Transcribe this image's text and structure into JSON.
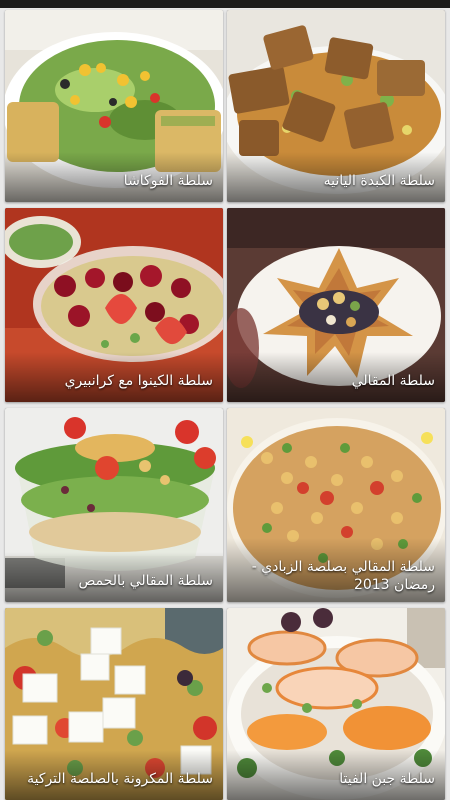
{
  "recipes": [
    {
      "title": "سلطة الفوكاشا"
    },
    {
      "title": "سلطة الكبدة اليانيه"
    },
    {
      "title": "سلطة الكينوا مع كرانبيري"
    },
    {
      "title": "سلطة المقالي"
    },
    {
      "title": "سلطة المقالي بالحمص"
    },
    {
      "title": "سلطة المقالي بصلصة الزبادي - رمضان 2013"
    },
    {
      "title": "سلطة المكرونة بالصلصة التركية"
    },
    {
      "title": "سلطة جبن الفيتا"
    }
  ],
  "icons": [
    "salad-photo"
  ],
  "colors": {
    "background": "#e8e8e8",
    "caption_text": "#ffffff",
    "status_bar": "#1b1b1b"
  }
}
